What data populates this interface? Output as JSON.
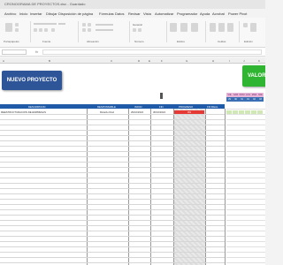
{
  "window": {
    "title": "CRONOGRAMA DE PROYECTOS.xlsx - Guardado"
  },
  "menu": [
    "Archivo",
    "Inicio",
    "Insertar",
    "Dibujar",
    "Disposición de página",
    "Fórmulas",
    "Datos",
    "Revisar",
    "Vista",
    "Automatizar",
    "Programador",
    "Ayuda",
    "Acrobat",
    "Power Pivot"
  ],
  "ribbon": {
    "groups": [
      "Portapapeles",
      "Fuente",
      "Alineación",
      "Número",
      "Estilos",
      "Celdas",
      "Edición"
    ],
    "format_label": "Formato condicional",
    "styles_label": "Estilos de celda",
    "number_format": "General"
  },
  "formula_bar": {
    "fx": "fx",
    "cell": "",
    "value": ""
  },
  "columns": [
    "A",
    "B",
    "C",
    "D",
    "E",
    "F",
    "G",
    "H",
    "I",
    "J",
    "K"
  ],
  "buttons": {
    "new_project": "NUEVO PROYECTO",
    "value": "VALOR T"
  },
  "calendar": {
    "days": [
      "VIE",
      "SAB",
      "DOM",
      "LUN",
      "MAR",
      "MIE"
    ],
    "nums": [
      "29",
      "30",
      "31",
      "01",
      "02",
      "03"
    ]
  },
  "table": {
    "headers": [
      "DESCRIPCION",
      "RESPONSABLE",
      "INICIO",
      "FIN",
      "PROGRESO",
      "FIN REAL"
    ],
    "rows": [
      {
        "desc": "REESTRUCTURACION DE EMPRESAS",
        "resp": "Ricardo Díaz",
        "start": "29/10/2024",
        "end": "30/10/2024",
        "progress": "0%",
        "progress_value": 0.0
      }
    ]
  },
  "colors": {
    "header_blue": "#1f5aa8",
    "button_blue": "#2e5597",
    "button_green": "#2fb531",
    "progress_red": "#e53935"
  }
}
